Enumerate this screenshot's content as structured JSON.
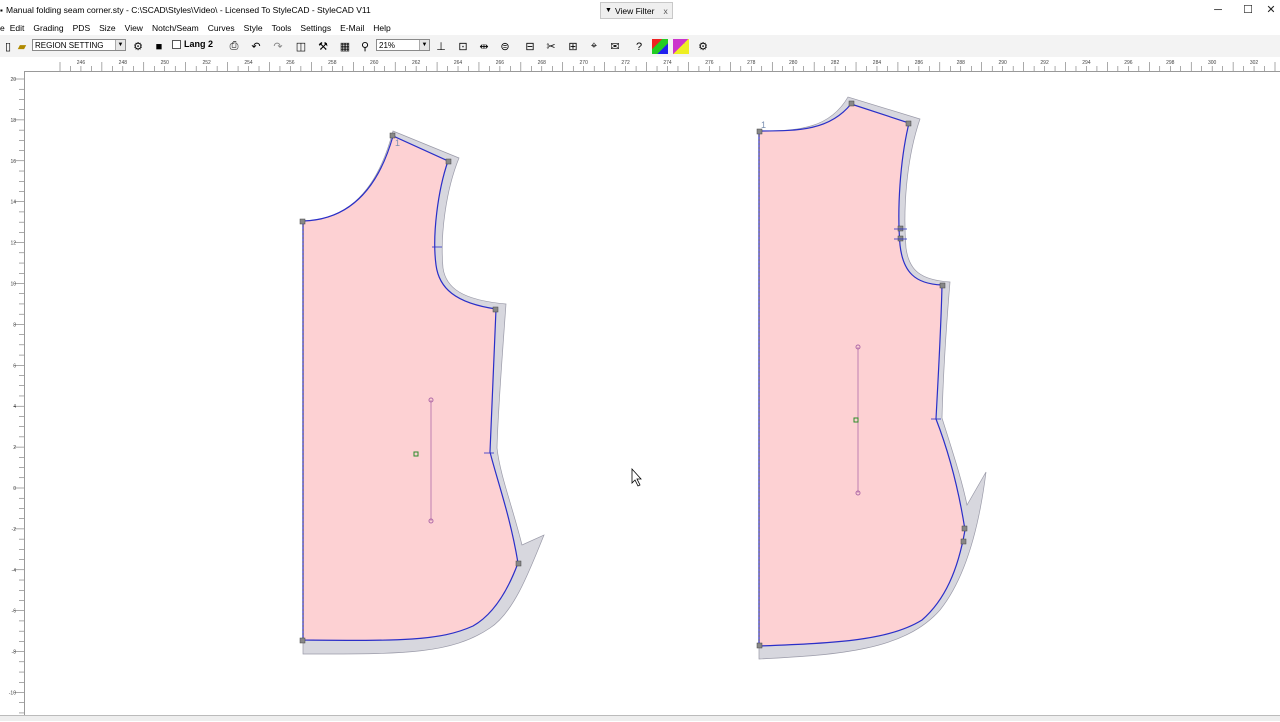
{
  "window": {
    "title": "Manual folding seam corner.sty - C:\\SCAD\\Styles\\Video\\ - Licensed To StyleCAD - StyleCAD V11",
    "controls": {
      "minimize": "─",
      "maximize": "☐",
      "close": "✕"
    }
  },
  "view_filter": {
    "label": "View Filter",
    "close": "x"
  },
  "menu": [
    "Edit",
    "Grading",
    "PDS",
    "Size",
    "View",
    "Notch/Seam",
    "Curves",
    "Style",
    "Tools",
    "Settings",
    "E-Mail",
    "Help"
  ],
  "toolbar": {
    "mode_select": "REGION SETTING",
    "lang_label": "Lang 2",
    "zoom_value": "21%"
  },
  "ruler_top": {
    "labels": [
      "246",
      "248",
      "250",
      "252",
      "254",
      "256",
      "258",
      "260",
      "262",
      "264",
      "266",
      "268",
      "270",
      "272",
      "274",
      "276",
      "278",
      "280",
      "282",
      "284",
      "286",
      "288",
      "290",
      "292",
      "294",
      "296",
      "298",
      "300",
      "302"
    ]
  },
  "ruler_left": {
    "labels": [
      "20",
      "18",
      "16",
      "14",
      "12",
      "10",
      "8",
      "6",
      "4",
      "2",
      "0",
      "-2",
      "-4",
      "-6",
      "-8",
      "-10"
    ]
  },
  "pieces": [
    {
      "name": "piece-left",
      "label": "1"
    },
    {
      "name": "piece-right",
      "label": "1"
    }
  ],
  "colors": {
    "piece_fill": "#fdd1d3",
    "seam_fill": "#d7d7de",
    "outline": "#2a2fc8",
    "grainline": "#b06aa8"
  }
}
